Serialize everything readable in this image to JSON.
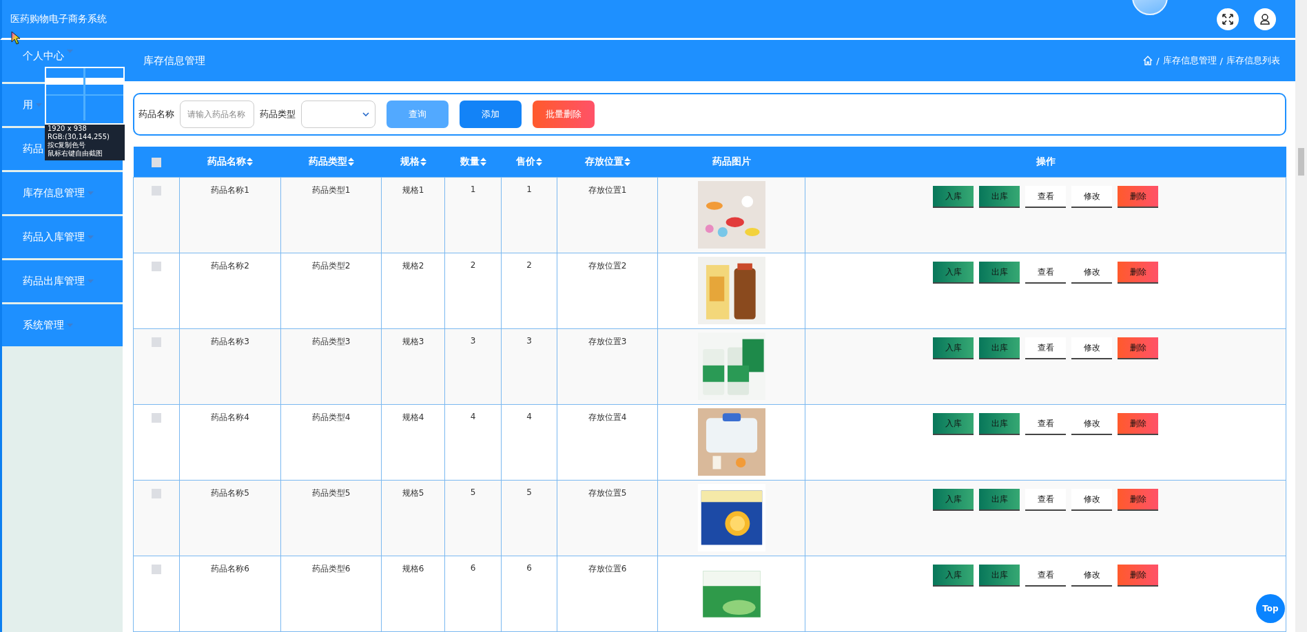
{
  "app": {
    "title": "医药购物电子商务系统"
  },
  "sidebar": {
    "items": [
      {
        "label": "个人中心"
      },
      {
        "label": "用"
      },
      {
        "label": "药品"
      },
      {
        "label": "库存信息管理"
      },
      {
        "label": "药品入库管理"
      },
      {
        "label": "药品出库管理"
      },
      {
        "label": "系统管理"
      }
    ]
  },
  "page_header": {
    "title": "库存信息管理",
    "breadcrumb": [
      {
        "separator": "/",
        "label": "库存信息管理"
      },
      {
        "separator": "/",
        "label": "库存信息列表"
      }
    ]
  },
  "filters": {
    "fields": [
      {
        "kind": "input",
        "label": "药品名称",
        "placeholder": "请输入药品名称"
      },
      {
        "kind": "select",
        "label": "药品类型"
      }
    ],
    "buttons": [
      {
        "kind": "search",
        "label": "查询"
      },
      {
        "kind": "add",
        "label": "添加"
      },
      {
        "kind": "delete",
        "label": "批量删除"
      }
    ]
  },
  "table": {
    "select_all": {
      "checked": false
    },
    "columns": [
      {
        "label": "药品名称",
        "sortable": true
      },
      {
        "label": "药品类型",
        "sortable": true
      },
      {
        "label": "规格",
        "sortable": true
      },
      {
        "label": "数量",
        "sortable": true
      },
      {
        "label": "售价",
        "sortable": true
      },
      {
        "label": "存放位置",
        "sortable": true
      },
      {
        "label": "药品图片",
        "sortable": false
      },
      {
        "label": "操作",
        "sortable": false
      }
    ],
    "rows": [
      {
        "checked": false,
        "cells": [
          "药品名称1",
          "药品类型1",
          "规格1",
          "1",
          "1",
          "存放位置1"
        ],
        "image": {
          "kind": "picture"
        },
        "actions": [
          {
            "kind": "stock",
            "label": "入库"
          },
          {
            "kind": "stock",
            "label": "出库"
          },
          {
            "kind": "plain",
            "label": "查看"
          },
          {
            "kind": "plain",
            "label": "修改"
          },
          {
            "kind": "danger",
            "label": "删除"
          }
        ]
      },
      {
        "checked": false,
        "cells": [
          "药品名称2",
          "药品类型2",
          "规格2",
          "2",
          "2",
          "存放位置2"
        ],
        "image": {
          "kind": "picture"
        },
        "actions": [
          {
            "kind": "stock",
            "label": "入库"
          },
          {
            "kind": "stock",
            "label": "出库"
          },
          {
            "kind": "plain",
            "label": "查看"
          },
          {
            "kind": "plain",
            "label": "修改"
          },
          {
            "kind": "danger",
            "label": "删除"
          }
        ]
      },
      {
        "checked": false,
        "cells": [
          "药品名称3",
          "药品类型3",
          "规格3",
          "3",
          "3",
          "存放位置3"
        ],
        "image": {
          "kind": "picture"
        },
        "actions": [
          {
            "kind": "stock",
            "label": "入库"
          },
          {
            "kind": "stock",
            "label": "出库"
          },
          {
            "kind": "plain",
            "label": "查看"
          },
          {
            "kind": "plain",
            "label": "修改"
          },
          {
            "kind": "danger",
            "label": "删除"
          }
        ]
      },
      {
        "checked": false,
        "cells": [
          "药品名称4",
          "药品类型4",
          "规格4",
          "4",
          "4",
          "存放位置4"
        ],
        "image": {
          "kind": "picture"
        },
        "actions": [
          {
            "kind": "stock",
            "label": "入库"
          },
          {
            "kind": "stock",
            "label": "出库"
          },
          {
            "kind": "plain",
            "label": "查看"
          },
          {
            "kind": "plain",
            "label": "修改"
          },
          {
            "kind": "danger",
            "label": "删除"
          }
        ]
      },
      {
        "checked": false,
        "cells": [
          "药品名称5",
          "药品类型5",
          "规格5",
          "5",
          "5",
          "存放位置5"
        ],
        "image": {
          "kind": "picture"
        },
        "actions": [
          {
            "kind": "stock",
            "label": "入库"
          },
          {
            "kind": "stock",
            "label": "出库"
          },
          {
            "kind": "plain",
            "label": "查看"
          },
          {
            "kind": "plain",
            "label": "修改"
          },
          {
            "kind": "danger",
            "label": "删除"
          }
        ]
      },
      {
        "checked": false,
        "cells": [
          "药品名称6",
          "药品类型6",
          "规格6",
          "6",
          "6",
          "存放位置6"
        ],
        "image": {
          "kind": "picture"
        },
        "actions": [
          {
            "kind": "stock",
            "label": "入库"
          },
          {
            "kind": "stock",
            "label": "出库"
          },
          {
            "kind": "plain",
            "label": "查看"
          },
          {
            "kind": "plain",
            "label": "修改"
          },
          {
            "kind": "danger",
            "label": "删除"
          }
        ]
      }
    ]
  },
  "back_to_top": {
    "label": "Top"
  },
  "capture_tool": {
    "lines": [
      "1920 x 938",
      "RGB:(30,144,255)",
      "按c复制色号",
      "鼠标右键自由截图"
    ]
  }
}
